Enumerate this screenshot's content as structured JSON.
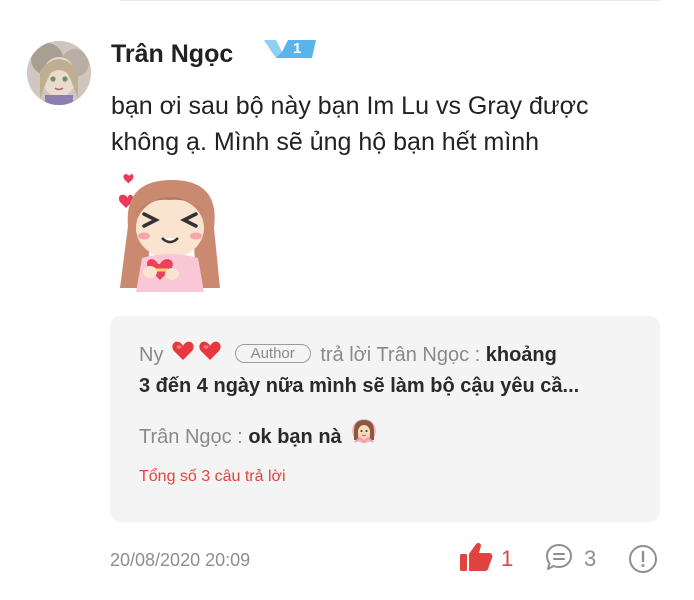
{
  "comment": {
    "author": "Trân Ngọc",
    "level": "1",
    "text": "bạn ơi sau bộ này bạn Im Lu vs Gray được không ạ. Mình sẽ ủng hộ bạn hết mình",
    "timestamp": "20/08/2020 20:09",
    "likes": "1",
    "replies_count": "3"
  },
  "replies": {
    "first": {
      "author": "Ny",
      "author_tag": "Author",
      "reply_to_label": "trả lời Trân Ngọc :",
      "text_line1": "khoảng",
      "text_line2": "3 đến 4 ngày nữa mình sẽ làm bộ cậu yêu cầ..."
    },
    "second": {
      "author": "Trân Ngọc :",
      "text": "ok bạn nà"
    },
    "total_label": "Tổng số 3 câu trả lời"
  },
  "colors": {
    "accent_red": "#e0443e",
    "level_badge": "#5ab4ec",
    "reply_bg": "#f4f4f4"
  },
  "icons": [
    "heart-icon",
    "level-badge-icon",
    "like-icon",
    "comment-icon",
    "report-icon"
  ]
}
